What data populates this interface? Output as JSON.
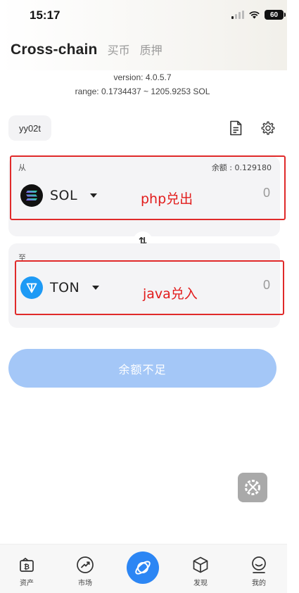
{
  "status_bar": {
    "time": "15:17",
    "battery": "60"
  },
  "header": {
    "title": "Cross-chain",
    "tabs": [
      "买币",
      "质押"
    ]
  },
  "info": {
    "version": "version: 4.0.5.7",
    "range": "range: 0.1734437 ~ 1205.9253 SOL"
  },
  "account": {
    "name": "yy02t"
  },
  "from_panel": {
    "label": "从",
    "balance": "余额 : 0.129180",
    "coin": "SOL",
    "amount": "0",
    "annotation": "php兑出"
  },
  "to_panel": {
    "label": "至",
    "coin": "TON",
    "amount": "0",
    "annotation": "java兑入"
  },
  "swap_symbol": "⇅",
  "submit": {
    "label": "余额不足"
  },
  "tabbar": {
    "items": [
      "资产",
      "市场",
      "",
      "发现",
      "我的"
    ]
  },
  "colors": {
    "accent": "#2c86f4",
    "button_disabled": "#a4c7f7",
    "annotation_red": "#e21b1b",
    "panel_bg": "#f4f4f6"
  },
  "icons": {
    "document": "document-icon",
    "settings": "gear-icon",
    "swap": "swap-icon",
    "sol": "solana-logo-icon",
    "ton": "ton-logo-icon"
  }
}
